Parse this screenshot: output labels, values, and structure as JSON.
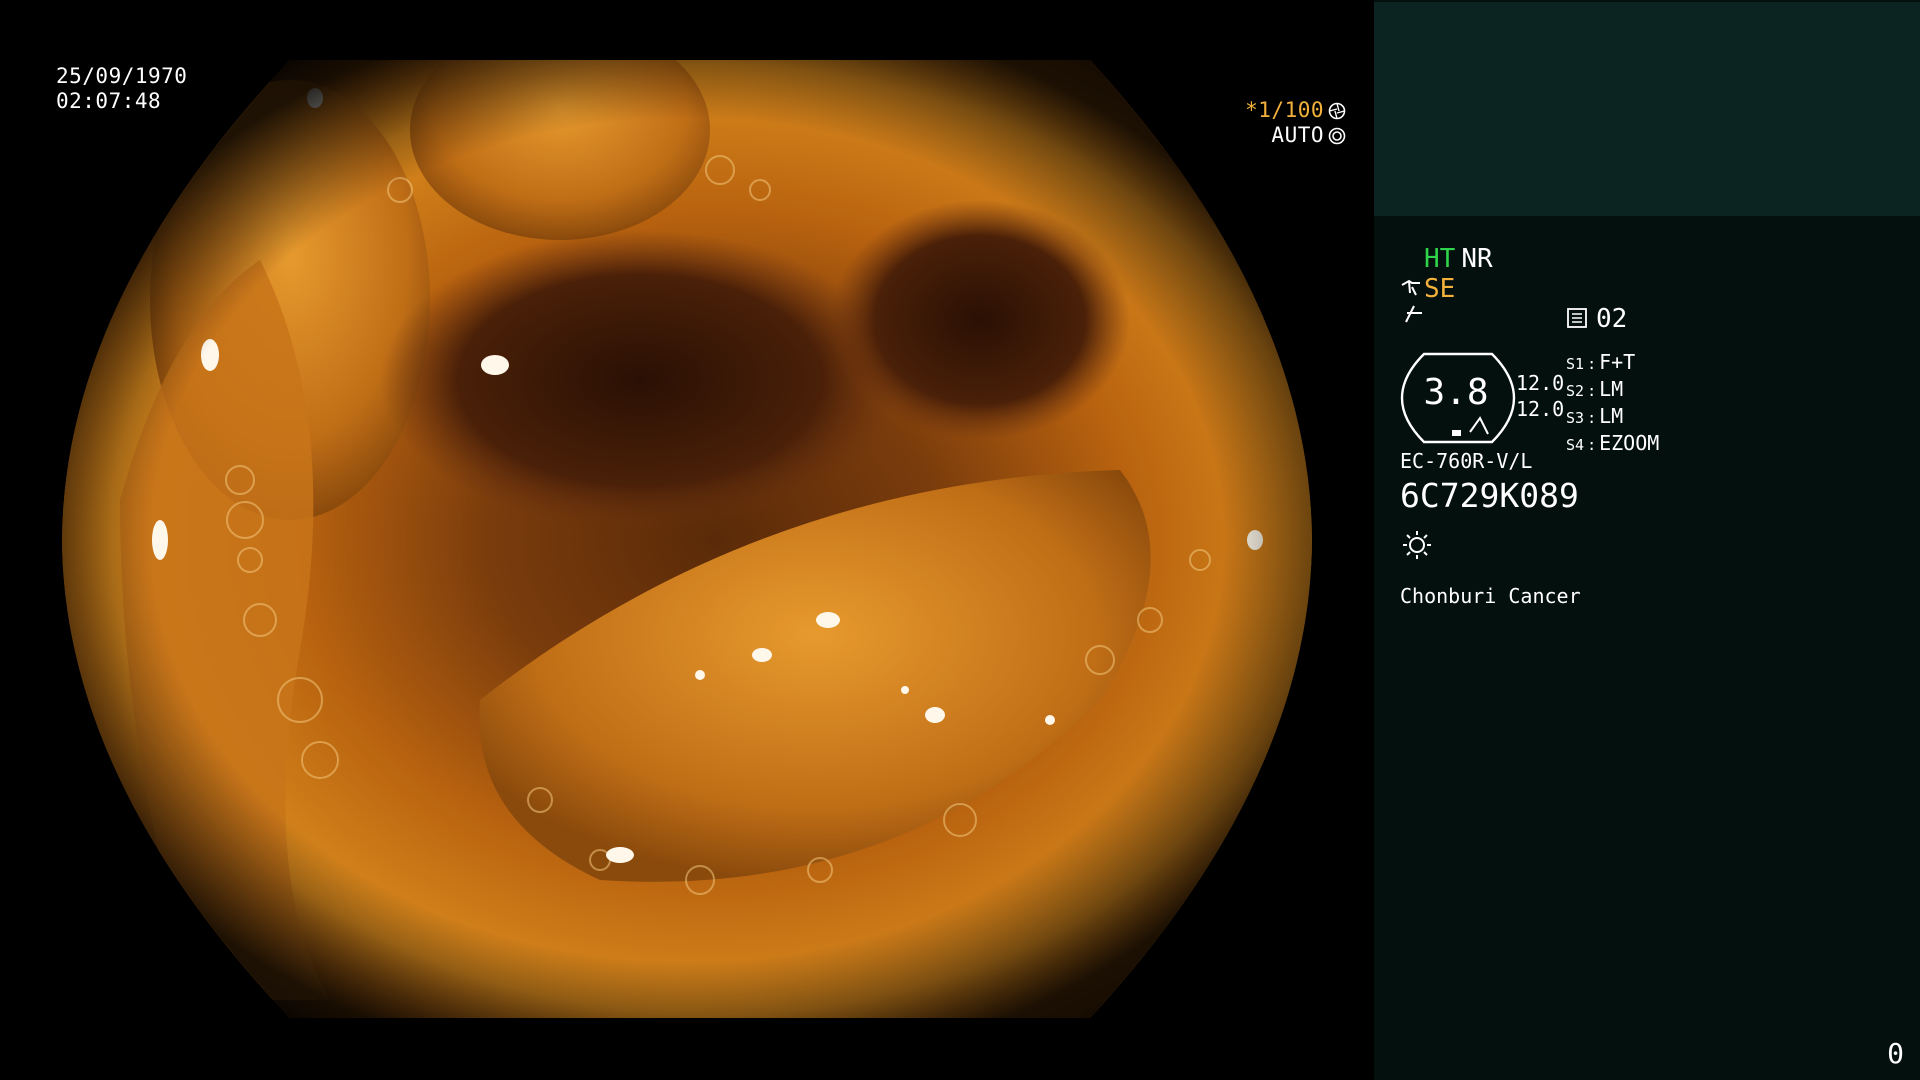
{
  "video": {
    "date": "25/09/1970",
    "time": "02:07:48",
    "shutter": "*1/100",
    "iris_mode": "AUTO",
    "icons": {
      "shutter": "aperture-icon",
      "iris": "iris-icon"
    }
  },
  "panel": {
    "enhancement": {
      "ht": "HT",
      "nr": "NR",
      "se": "SE"
    },
    "icons": {
      "se": "scope-enhance-icon",
      "structure": "structure-icon",
      "mode": "monitor-mode-icon",
      "light": "light-source-icon"
    },
    "mode_value": "02",
    "gauge": {
      "value": "3.8",
      "upper": "12.0",
      "lower": "12.0"
    },
    "settings": [
      {
        "key": "S1",
        "value": "F+T"
      },
      {
        "key": "S2",
        "value": "LM"
      },
      {
        "key": "S3",
        "value": "LM"
      },
      {
        "key": "S4",
        "value": "EZOOM"
      }
    ],
    "scope_model": "EC-760R-V/L",
    "scope_serial": "6C729K089",
    "hospital": "Chonburi Cancer",
    "frame_count": "0"
  },
  "colors": {
    "panel_bg": "#04100e",
    "panel_header_bg": "#0b2422",
    "ht_green": "#2fd44a",
    "amber": "#f4b23c",
    "text": "#ffffff"
  }
}
